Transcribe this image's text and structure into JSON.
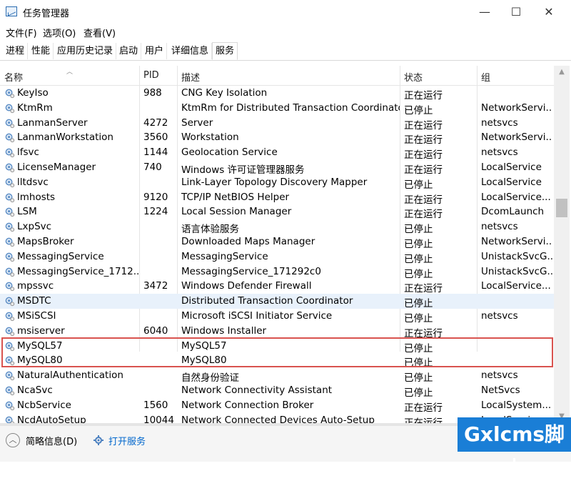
{
  "window": {
    "title": "任务管理器",
    "minimize": "—",
    "maximize": "☐",
    "close": "✕"
  },
  "menu": [
    "文件(F)",
    "选项(O)",
    "查看(V)"
  ],
  "tabs": [
    "进程",
    "性能",
    "应用历史记录",
    "启动",
    "用户",
    "详细信息",
    "服务"
  ],
  "active_tab": "服务",
  "columns": {
    "name": "名称",
    "pid": "PID",
    "desc": "描述",
    "status": "状态",
    "group": "组"
  },
  "rows": [
    {
      "name": "KeyIso",
      "pid": "988",
      "desc": "CNG Key Isolation",
      "status": "正在运行",
      "group": ""
    },
    {
      "name": "KtmRm",
      "pid": "",
      "desc": "KtmRm for Distributed Transaction Coordinator",
      "status": "已停止",
      "group": "NetworkServi..."
    },
    {
      "name": "LanmanServer",
      "pid": "4272",
      "desc": "Server",
      "status": "正在运行",
      "group": "netsvcs"
    },
    {
      "name": "LanmanWorkstation",
      "pid": "3560",
      "desc": "Workstation",
      "status": "正在运行",
      "group": "NetworkServi..."
    },
    {
      "name": "lfsvc",
      "pid": "1144",
      "desc": "Geolocation Service",
      "status": "正在运行",
      "group": "netsvcs"
    },
    {
      "name": "LicenseManager",
      "pid": "740",
      "desc": "Windows 许可证管理器服务",
      "status": "正在运行",
      "group": "LocalService"
    },
    {
      "name": "lltdsvc",
      "pid": "",
      "desc": "Link-Layer Topology Discovery Mapper",
      "status": "已停止",
      "group": "LocalService"
    },
    {
      "name": "lmhosts",
      "pid": "9120",
      "desc": "TCP/IP NetBIOS Helper",
      "status": "正在运行",
      "group": "LocalService..."
    },
    {
      "name": "LSM",
      "pid": "1224",
      "desc": "Local Session Manager",
      "status": "正在运行",
      "group": "DcomLaunch"
    },
    {
      "name": "LxpSvc",
      "pid": "",
      "desc": "语言体验服务",
      "status": "已停止",
      "group": "netsvcs"
    },
    {
      "name": "MapsBroker",
      "pid": "",
      "desc": "Downloaded Maps Manager",
      "status": "已停止",
      "group": "NetworkServi..."
    },
    {
      "name": "MessagingService",
      "pid": "",
      "desc": "MessagingService",
      "status": "已停止",
      "group": "UnistackSvcG..."
    },
    {
      "name": "MessagingService_1712...",
      "pid": "",
      "desc": "MessagingService_171292c0",
      "status": "已停止",
      "group": "UnistackSvcG..."
    },
    {
      "name": "mpssvc",
      "pid": "3472",
      "desc": "Windows Defender Firewall",
      "status": "正在运行",
      "group": "LocalService..."
    },
    {
      "name": "MSDTC",
      "pid": "",
      "desc": "Distributed Transaction Coordinator",
      "status": "已停止",
      "group": "",
      "selected": true
    },
    {
      "name": "MSiSCSI",
      "pid": "",
      "desc": "Microsoft iSCSI Initiator Service",
      "status": "已停止",
      "group": "netsvcs"
    },
    {
      "name": "msiserver",
      "pid": "6040",
      "desc": "Windows Installer",
      "status": "正在运行",
      "group": ""
    },
    {
      "name": "MySQL57",
      "pid": "",
      "desc": "MySQL57",
      "status": "已停止",
      "group": ""
    },
    {
      "name": "MySQL80",
      "pid": "",
      "desc": "MySQL80",
      "status": "已停止",
      "group": ""
    },
    {
      "name": "NaturalAuthentication",
      "pid": "",
      "desc": "自然身份验证",
      "status": "已停止",
      "group": "netsvcs"
    },
    {
      "name": "NcaSvc",
      "pid": "",
      "desc": "Network Connectivity Assistant",
      "status": "已停止",
      "group": "NetSvcs"
    },
    {
      "name": "NcbService",
      "pid": "1560",
      "desc": "Network Connection Broker",
      "status": "正在运行",
      "group": "LocalSystem..."
    },
    {
      "name": "NcdAutoSetup",
      "pid": "10044",
      "desc": "Network Connected Devices Auto-Setup",
      "status": "正在运行",
      "group": "LocalService..."
    }
  ],
  "footer": {
    "fewer_details": "简略信息(D)",
    "open_services": "打开服务"
  },
  "watermark": "Gxlcms脚本",
  "colors": {
    "highlight_border": "#d9534f",
    "selected_row": "#e8f1fb",
    "link": "#0066cc",
    "watermark_bg": "#1a7ed6"
  }
}
